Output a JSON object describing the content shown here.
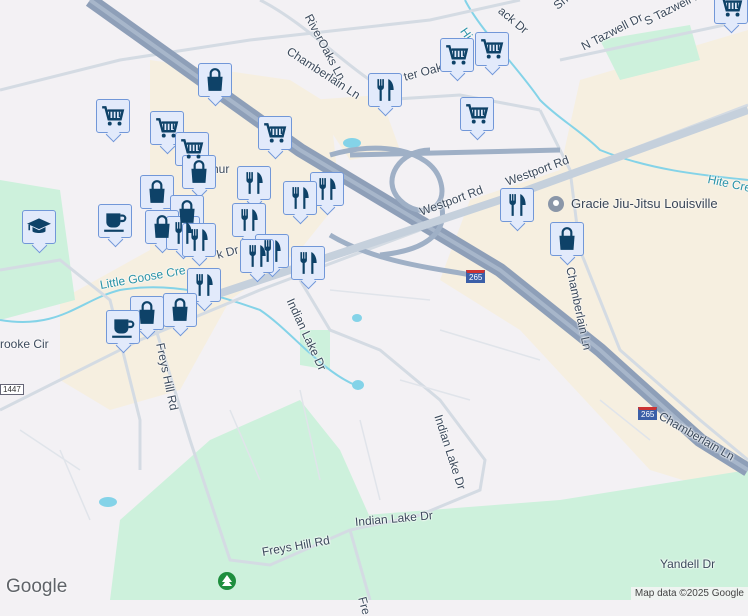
{
  "map": {
    "roads": {
      "riveroaks": "RiverOaks Ln",
      "chamberlain_top": "Chamberlain Ln",
      "foster_oak": "ter Oak",
      "n_tazwell": "N Tazwell Dr",
      "s_tazwell": "S Tazwell Dr",
      "she": "She",
      "ack": "ack Dr",
      "westport_1": "Westport Rd",
      "westport_2": "Westport Rd",
      "hite_creek": "Hite Cre",
      "hite_top": "Hi",
      "chamberlain_right": "Chamberlain Ln",
      "chamberlain_v": "Chamberlain Ln",
      "indian_lake_1": "Indian Lake Dr",
      "indian_lake_2": "Indian Lake Dr",
      "indian_lake_3": "Indian Lake Dr",
      "freys_hill_v": "Freys Hill Rd",
      "freys_hill_h": "Freys Hill Rd",
      "freys_bottom": "Fre",
      "yandell": "Yandell Dr",
      "brooke": "rooke Cir",
      "little_goose": "Little Goose Cre",
      "dr_x": "k Dr",
      "lyndon": "hur"
    },
    "shields": {
      "i265_a": "265",
      "i265_b": "265",
      "ky1447": "1447"
    },
    "poi": {
      "gracie": "Gracie Jiu-Jitsu Louisville"
    },
    "branding": {
      "logo": "Google",
      "attribution": "Map data ©2025 Google"
    },
    "colors": {
      "pin_fill": "#e2eafb",
      "pin_border": "#7197d8",
      "icon": "#0e4268",
      "highway": "#8e9fb8",
      "park": "#cdf1dc",
      "commercial": "#f6efe0"
    }
  }
}
